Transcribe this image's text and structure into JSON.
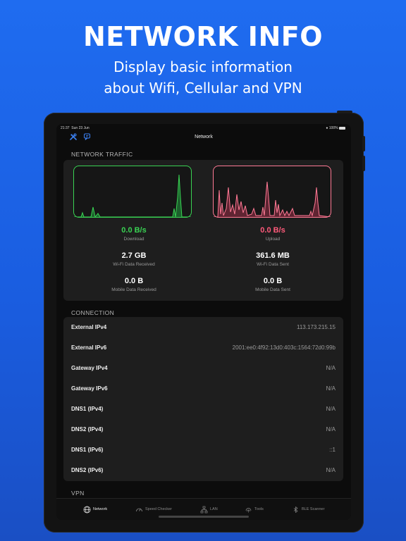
{
  "hero": {
    "title": "NETWORK INFO",
    "subtitle_line1": "Display basic information",
    "subtitle_line2": "about Wifi, Cellular and VPN"
  },
  "status_bar": {
    "time": "21:37",
    "date": "Sun 23 Jun",
    "battery": "100%"
  },
  "nav": {
    "title": "Network",
    "left_icons": [
      "tools-icon",
      "chat-icon"
    ]
  },
  "traffic": {
    "header": "NETWORK TRAFFIC",
    "download": {
      "value": "0.0 B/s",
      "label": "Download",
      "color": "#39d353"
    },
    "upload": {
      "value": "0.0 B/s",
      "label": "Upload",
      "color": "#ff5a7a"
    },
    "wifi_received": {
      "value": "2.7 GB",
      "label": "Wi-Fi Data Received"
    },
    "wifi_sent": {
      "value": "361.6 MB",
      "label": "Wi-Fi Data Sent"
    },
    "mobile_received": {
      "value": "0.0 B",
      "label": "Mobile Data Received"
    },
    "mobile_sent": {
      "value": "0.0 B",
      "label": "Mobile Data Sent"
    }
  },
  "connection": {
    "header": "CONNECTION",
    "rows": [
      {
        "label": "External IPv4",
        "value": "113.173.215.15"
      },
      {
        "label": "External IPv6",
        "value": "2001:ee0:4f92:13d0:403c:1564:72d0:99b"
      },
      {
        "label": "Gateway IPv4",
        "value": "N/A"
      },
      {
        "label": "Gateway IPv6",
        "value": "N/A"
      },
      {
        "label": "DNS1 (IPv4)",
        "value": "N/A"
      },
      {
        "label": "DNS2 (IPv4)",
        "value": "N/A"
      },
      {
        "label": "DNS1 (IPv6)",
        "value": "::1"
      },
      {
        "label": "DNS2 (IPv6)",
        "value": "N/A"
      }
    ]
  },
  "vpn": {
    "header": "VPN"
  },
  "tabs": [
    {
      "label": "Network",
      "icon": "globe-icon",
      "active": true
    },
    {
      "label": "Speed Checker",
      "icon": "speedometer-icon",
      "active": false
    },
    {
      "label": "LAN",
      "icon": "lan-icon",
      "active": false
    },
    {
      "label": "Tools",
      "icon": "fingerprint-icon",
      "active": false
    },
    {
      "label": "BLE Scanner",
      "icon": "bluetooth-icon",
      "active": false
    }
  ]
}
